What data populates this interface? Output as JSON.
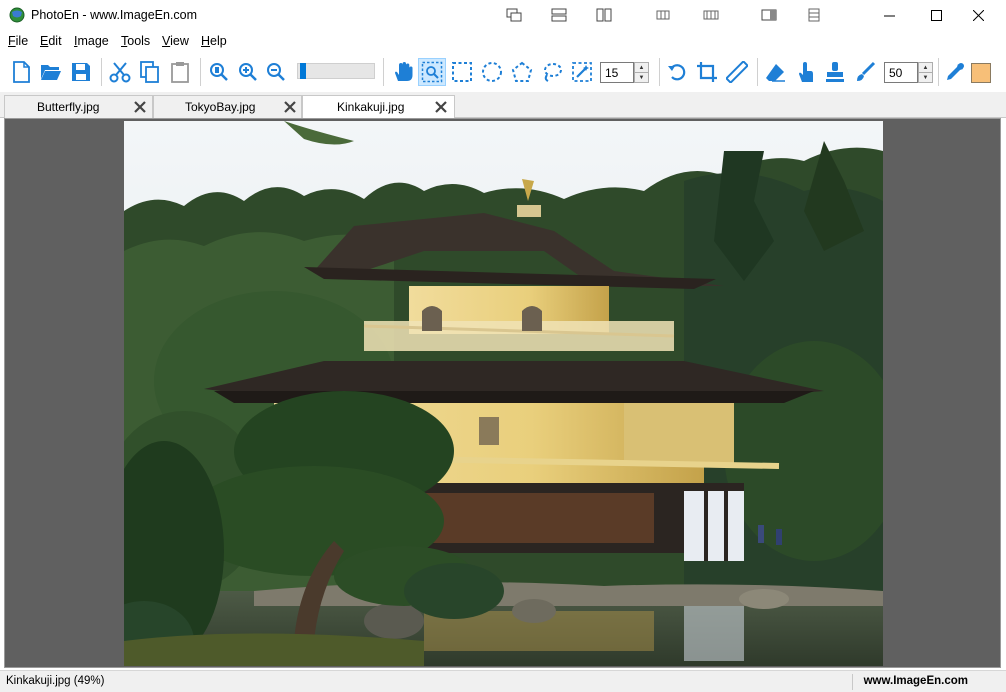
{
  "window": {
    "title": "PhotoEn - www.ImageEn.com",
    "icon": "globe-icon"
  },
  "menu": {
    "items": [
      {
        "label": "File",
        "key": "F"
      },
      {
        "label": "Edit",
        "key": "E"
      },
      {
        "label": "Image",
        "key": "I"
      },
      {
        "label": "Tools",
        "key": "T"
      },
      {
        "label": "View",
        "key": "V"
      },
      {
        "label": "Help",
        "key": "H"
      }
    ]
  },
  "toolbar": {
    "selection_value": "15",
    "brush_size_value": "50",
    "zoom_percent": 5,
    "color": "#f7bf78",
    "accent": "#1e7fd6"
  },
  "tabs": [
    {
      "label": "Butterfly.jpg",
      "active": false
    },
    {
      "label": "TokyoBay.jpg",
      "active": false
    },
    {
      "label": "Kinkakuji.jpg",
      "active": true
    }
  ],
  "status": {
    "left": "Kinkakuji.jpg (49%)",
    "right": "www.ImageEn.com"
  }
}
